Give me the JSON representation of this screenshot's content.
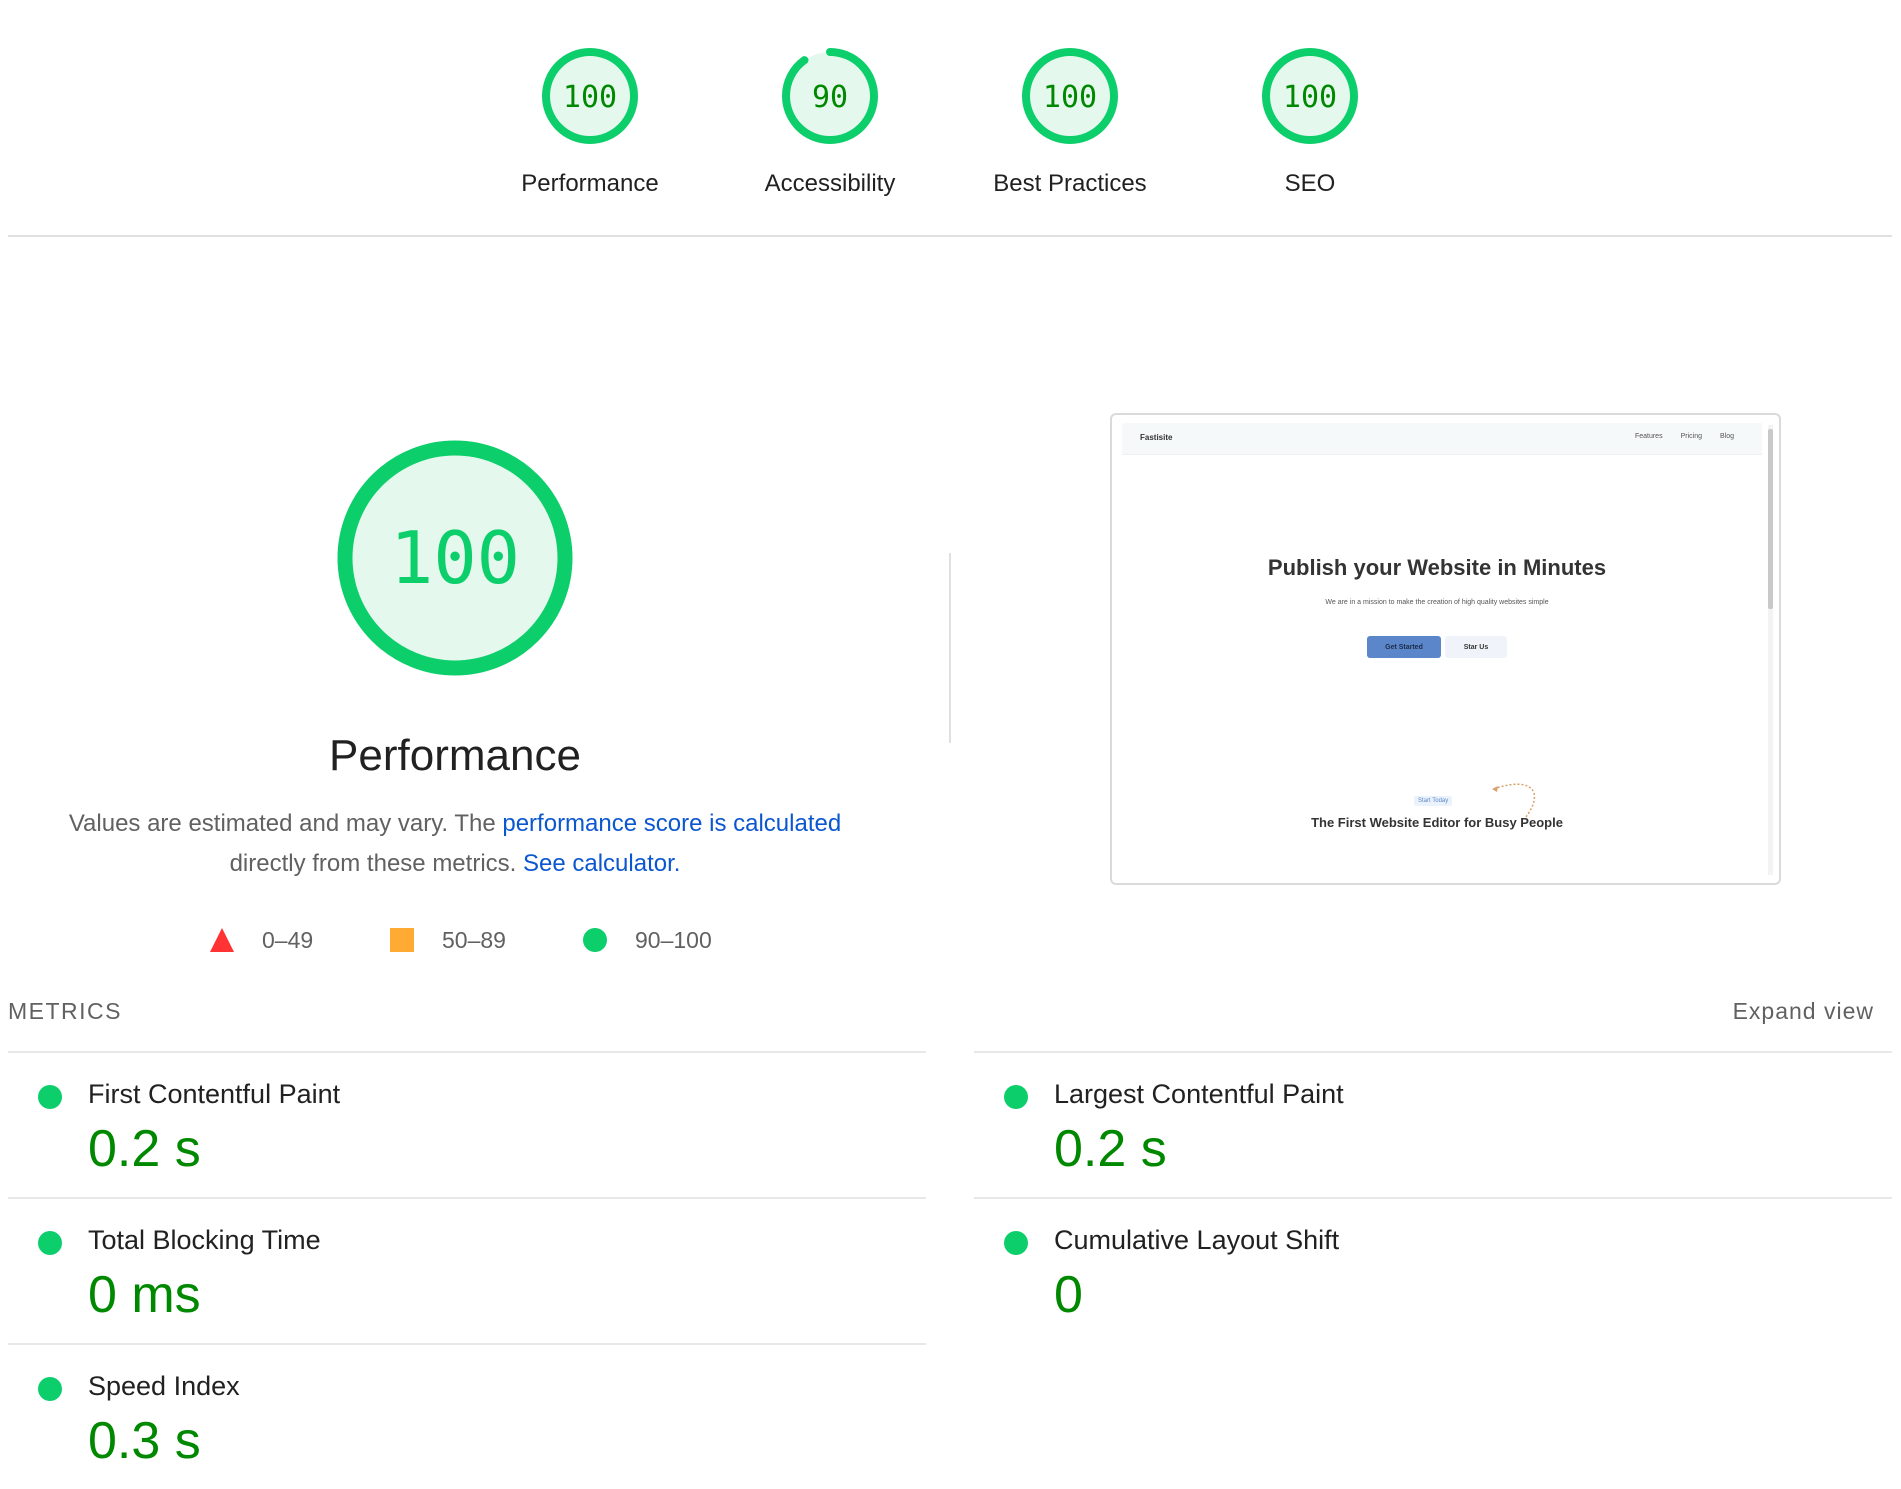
{
  "categories": [
    {
      "label": "Performance",
      "score": 100
    },
    {
      "label": "Accessibility",
      "score": 90
    },
    {
      "label": "Best Practices",
      "score": 100
    },
    {
      "label": "SEO",
      "score": 100
    }
  ],
  "colors": {
    "pass": "#0cce6b",
    "pass_fill": "#e5f8ee",
    "pass_text": "#008800",
    "average": "#ffaa33",
    "fail": "#ff3333",
    "link": "#0b57d0"
  },
  "performance": {
    "score": 100,
    "title": "Performance",
    "desc_prefix": "Values are estimated and may vary. The ",
    "desc_link1": "performance score is calculated",
    "desc_middle": " directly from these metrics. ",
    "desc_link2": "See calculator."
  },
  "legend": [
    {
      "icon": "fail-triangle-icon",
      "range": "0–49"
    },
    {
      "icon": "average-square-icon",
      "range": "50–89"
    },
    {
      "icon": "pass-circle-icon",
      "range": "90–100"
    }
  ],
  "screenshot": {
    "brand": "Fastisite",
    "nav_links": [
      "Features",
      "Pricing",
      "Blog"
    ],
    "headline": "Publish your Website in Minutes",
    "subhead": "We are in a mission to make the creation of high quality websites simple",
    "primary_button": "Get Started",
    "secondary_button": "Star Us",
    "badge": "Start Today",
    "section_title": "The First Website Editor for Busy People"
  },
  "metrics": {
    "header": "METRICS",
    "expand_label": "Expand view",
    "left": [
      {
        "name": "First Contentful Paint",
        "value": "0.2 s",
        "status": "pass"
      },
      {
        "name": "Total Blocking Time",
        "value": "0 ms",
        "status": "pass"
      },
      {
        "name": "Speed Index",
        "value": "0.3 s",
        "status": "pass"
      }
    ],
    "right": [
      {
        "name": "Largest Contentful Paint",
        "value": "0.2 s",
        "status": "pass"
      },
      {
        "name": "Cumulative Layout Shift",
        "value": "0",
        "status": "pass"
      }
    ]
  }
}
